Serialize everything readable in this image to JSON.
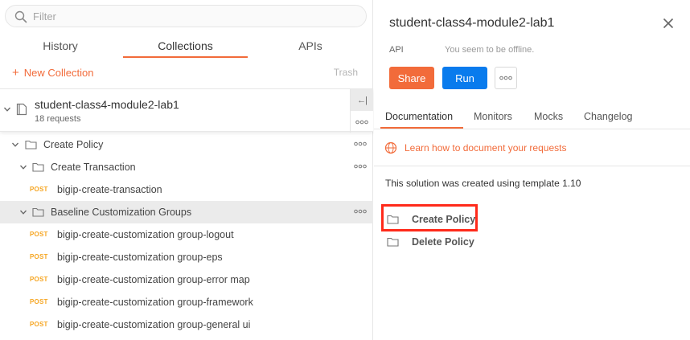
{
  "colors": {
    "accent": "#f26b3a",
    "run_button": "#097bed",
    "post_method": "#f6a623",
    "highlight_box": "#ff2a1a"
  },
  "sidebar": {
    "search": {
      "placeholder": "Filter",
      "value": "",
      "icon": "search-icon"
    },
    "tabs": [
      {
        "label": "History",
        "active": false
      },
      {
        "label": "Collections",
        "active": true
      },
      {
        "label": "APIs",
        "active": false
      }
    ],
    "new_collection_plus": "+",
    "new_collection_label": "New Collection",
    "trash_label": "Trash",
    "collection": {
      "name": "student-class4-module2-lab1",
      "requests": "18 requests",
      "collapse_glyph": "←|"
    },
    "tree": [
      {
        "kind": "folder",
        "label": "Create Policy"
      },
      {
        "kind": "folder",
        "label": "Create Transaction"
      },
      {
        "kind": "request",
        "method": "POST",
        "label": "bigip-create-transaction"
      },
      {
        "kind": "folder",
        "label": "Baseline Customization Groups",
        "selected": true
      },
      {
        "kind": "request",
        "method": "POST",
        "label": "bigip-create-customization group-logout"
      },
      {
        "kind": "request",
        "method": "POST",
        "label": "bigip-create-customization group-eps"
      },
      {
        "kind": "request",
        "method": "POST",
        "label": "bigip-create-customization group-error map"
      },
      {
        "kind": "request",
        "method": "POST",
        "label": "bigip-create-customization group-framework"
      },
      {
        "kind": "request",
        "method": "POST",
        "label": "bigip-create-customization group-general ui"
      }
    ]
  },
  "detail": {
    "title": "student-class4-module2-lab1",
    "type": "API",
    "offline_text": "You seem to be offline.",
    "share_label": "Share",
    "run_label": "Run",
    "tabs": [
      {
        "label": "Documentation",
        "active": true
      },
      {
        "label": "Monitors",
        "active": false
      },
      {
        "label": "Mocks",
        "active": false
      },
      {
        "label": "Changelog",
        "active": false
      }
    ],
    "learn_link": "Learn how to document your requests",
    "description": "This solution was created using template 1.10",
    "folders": [
      {
        "label": "Create Policy",
        "highlighted": true
      },
      {
        "label": "Delete Policy",
        "highlighted": false
      }
    ]
  }
}
